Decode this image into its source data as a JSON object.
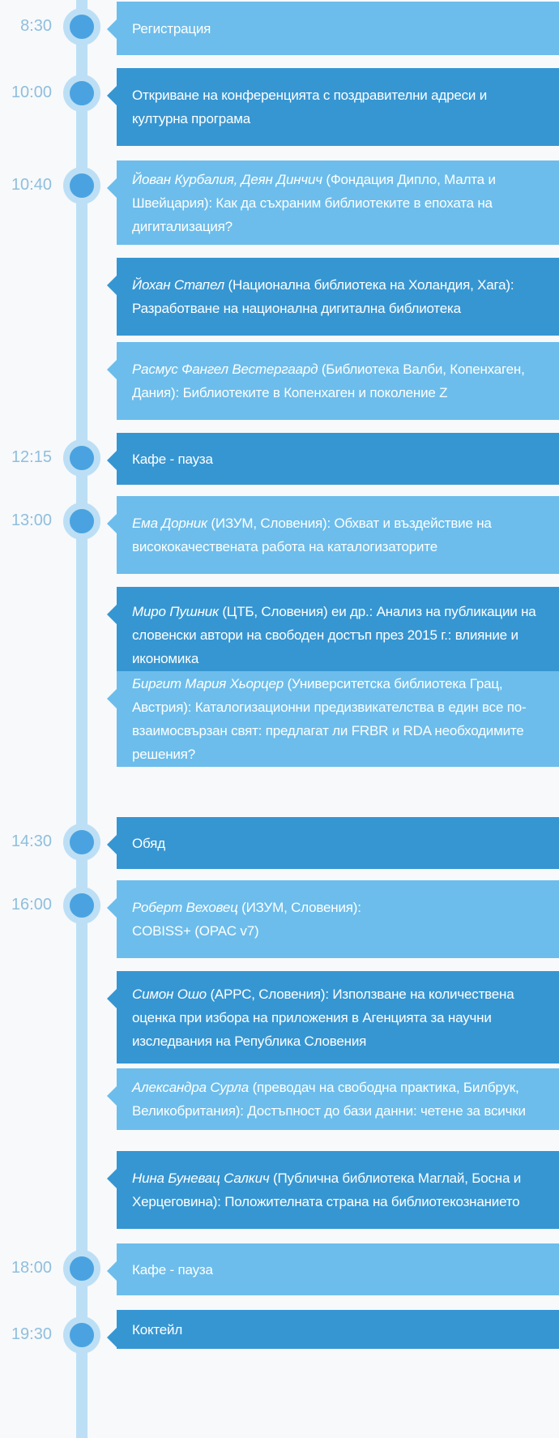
{
  "schedule": [
    {
      "time": "8:30",
      "items": [
        {
          "text": "Регистрация"
        }
      ]
    },
    {
      "time": "10:00",
      "items": [
        {
          "text": "Откриване на конференцията с поздравителни адреси и културна програма"
        }
      ]
    },
    {
      "time": "10:40",
      "items": [
        {
          "speaker": "Йован Курбалия, Деян Динчич",
          "text": " (Фондация Дипло, Малта и Швейцария): Как да съхраним библиотеките в епохата на дигитализация?"
        },
        {
          "speaker": "Йохан Стапел",
          "text": " (Национална библиотека на Холандия, Хага): Разработване на национална дигитална библиотека"
        },
        {
          "speaker": "Расмус Фангел Вестергаард",
          "text": " (Библиотека Валби, Копенхаген, Дания): Библиотеките в Копенхаген и поколение Z"
        }
      ]
    },
    {
      "time": "12:15",
      "items": [
        {
          "text": "Кафе - пауза"
        }
      ]
    },
    {
      "time": "13:00",
      "items": [
        {
          "speaker": "Ема Дорник",
          "text": " (ИЗУМ, Словения): Обхват и въздействие на висококачествената работа на каталогизаторите"
        },
        {
          "speaker": "Миро Пушник",
          "text": " (ЦТБ, Словения) еи др.: Анализ на публикации на словенски автори на свободен достъп през 2015 г.: влияние и икономика"
        },
        {
          "speaker": "Биргит Мария Хьорцер",
          "text": " (Университетска библиотека Грац, Австрия): Каталогизационни предизвикателства в един все по-взаимосвързан свят: предлагат ли FRBR и RDA необходимите решения?"
        }
      ]
    },
    {
      "time": "14:30",
      "items": [
        {
          "text": "Обяд"
        }
      ]
    },
    {
      "time": "16:00",
      "items": [
        {
          "speaker": "Роберт Веховец",
          "text": " (ИЗУМ, Словения):\nCOBISS+ (OPAC v7)"
        },
        {
          "speaker": "Симон Ошо",
          "text": " (АРРС, Словения): Използване на количествена оценка при избора на приложения в Агенцията за научни изследвания на Република Словения"
        },
        {
          "speaker": "Александра Сурла",
          "text": " (преводач на свободна практика, Билбрук, Великобритания): Достъпност до бази данни: четене за всички"
        },
        {
          "speaker": "Нина Буневац Салкич",
          "text": " (Публична библиотека Маглай, Босна и Херцеговина): Положителната страна на библиотекознанието"
        }
      ]
    },
    {
      "time": "18:00",
      "items": [
        {
          "text": "Кафе - пауза"
        }
      ]
    },
    {
      "time": "19:30",
      "items": [
        {
          "text": "Коктейл"
        }
      ]
    }
  ]
}
